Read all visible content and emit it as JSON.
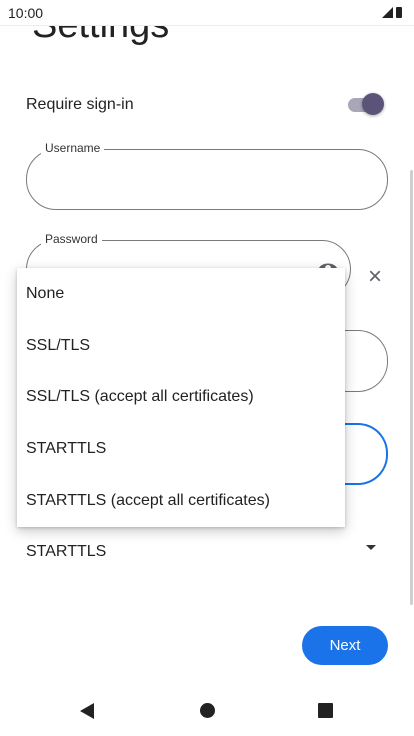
{
  "status_bar": {
    "time": "10:00",
    "icons": [
      "signal-icon",
      "battery-icon"
    ]
  },
  "header": {
    "title": "Settings"
  },
  "signin": {
    "label": "Require sign-in",
    "enabled": true
  },
  "username": {
    "label": "Username",
    "value": ""
  },
  "password": {
    "label": "Password",
    "value": ""
  },
  "security": {
    "selected": "STARTTLS",
    "options": [
      "None",
      "SSL/TLS",
      "SSL/TLS (accept all certificates)",
      "STARTTLS",
      "STARTTLS (accept all certificates)"
    ]
  },
  "actions": {
    "next_label": "Next"
  },
  "colors": {
    "accent": "#1a73e8",
    "toggle_thumb": "#5b5478",
    "toggle_track": "#a9a6b8"
  },
  "nav": {
    "icons": [
      "back-icon",
      "home-icon",
      "recents-icon"
    ]
  }
}
